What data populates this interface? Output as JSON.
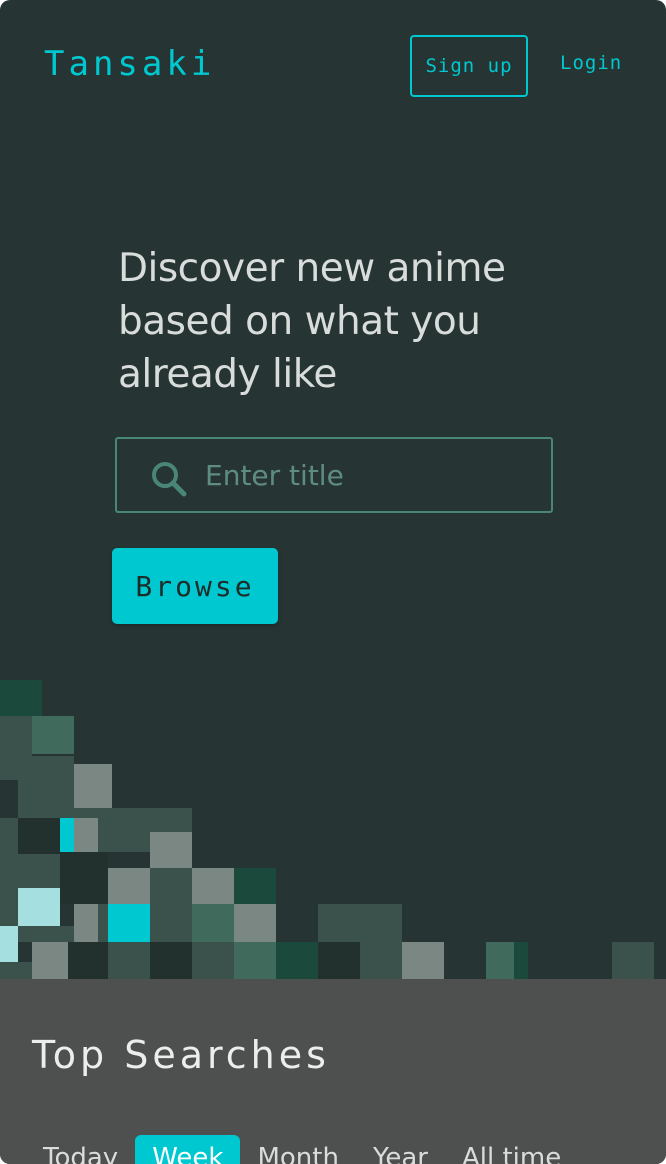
{
  "header": {
    "logo": "Tansaki",
    "signup_label": "Sign up",
    "login_label": "Login"
  },
  "hero": {
    "title_lines": [
      "Discover new anime",
      "based on what you",
      "already like"
    ],
    "search": {
      "placeholder": "Enter title",
      "value": ""
    },
    "browse_label": "Browse"
  },
  "top_searches": {
    "title": "Top Searches",
    "tabs": [
      {
        "label": "Today",
        "active": false
      },
      {
        "label": "Week",
        "active": true
      },
      {
        "label": "Month",
        "active": false
      },
      {
        "label": "Year",
        "active": false
      },
      {
        "label": "All time",
        "active": false
      }
    ]
  },
  "colors": {
    "background": "#263533",
    "accent": "#00c8d0",
    "panel": "#4e4f4f",
    "text": "#d8dcda"
  },
  "icons": {
    "search": "search-icon"
  }
}
